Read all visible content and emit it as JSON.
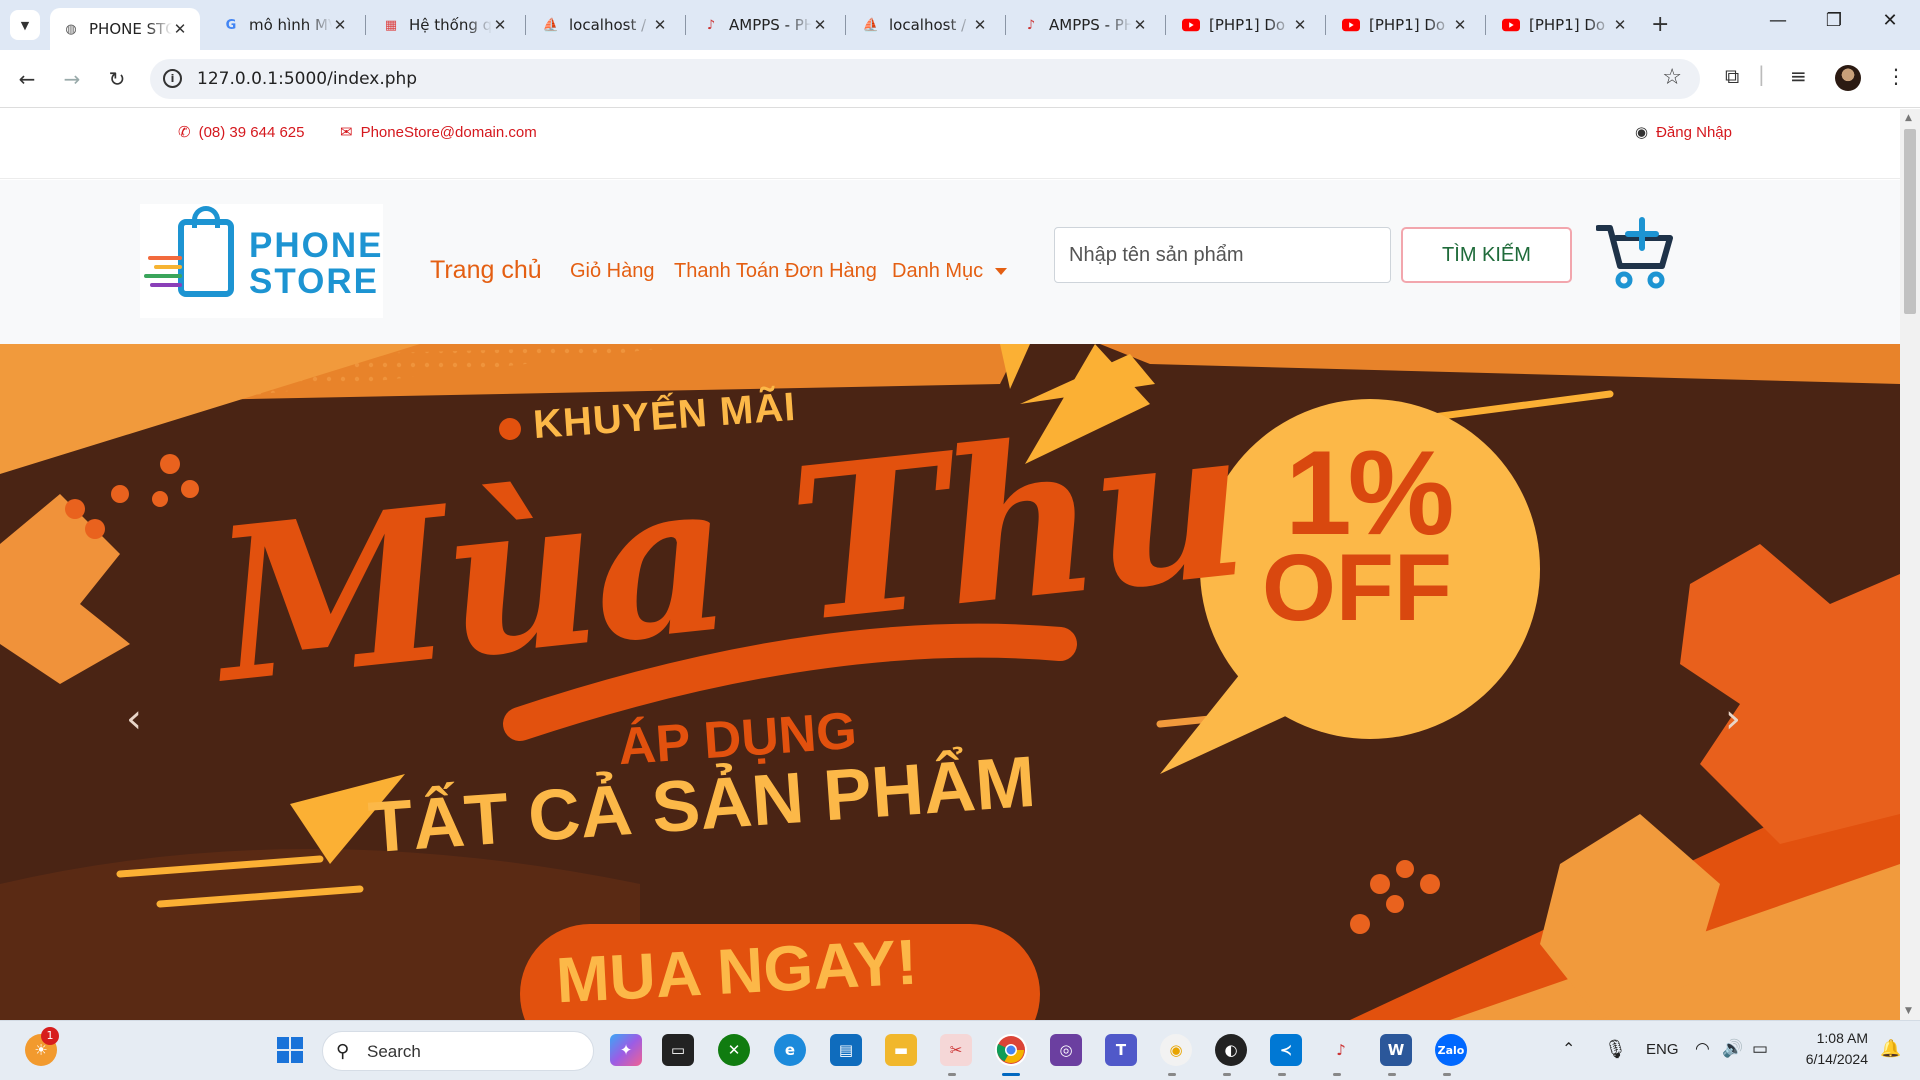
{
  "browser": {
    "tabs": [
      {
        "title": "PHONE STORE",
        "favicon": "globe-icon",
        "active": true
      },
      {
        "title": "mô hình MVC",
        "favicon": "google-icon",
        "active": false
      },
      {
        "title": "Hệ thống quản lý",
        "favicon": "site-icon",
        "active": false
      },
      {
        "title": "localhost / phpMyAdmin",
        "favicon": "phpmyadmin-icon",
        "active": false
      },
      {
        "title": "AMPPS - PHP",
        "favicon": "ampps-icon",
        "active": false
      },
      {
        "title": "localhost / phpMyAdmin",
        "favicon": "phpmyadmin-icon",
        "active": false
      },
      {
        "title": "AMPPS - PHP",
        "favicon": "ampps-icon",
        "active": false
      },
      {
        "title": "[PHP1] Do",
        "favicon": "youtube-icon",
        "active": false
      },
      {
        "title": "[PHP1] Do",
        "favicon": "youtube-icon",
        "active": false
      },
      {
        "title": "[PHP1] Do",
        "favicon": "youtube-icon",
        "active": false
      }
    ],
    "close_glyph": "✕",
    "new_tab_glyph": "+",
    "url": "127.0.0.1:5000/index.php"
  },
  "topbar": {
    "phone": "(08) 39 644 625",
    "email": "PhoneStore@domain.com",
    "login": "Đăng Nhập"
  },
  "header": {
    "logo_line1": "PHONE",
    "logo_line2": "STORE",
    "nav": {
      "home": "Trang chủ",
      "cart": "Giỏ Hàng",
      "checkout": "Thanh Toán Đơn Hàng",
      "category": "Danh Mục"
    },
    "search_placeholder": "Nhập tên sản phẩm",
    "search_button": "TÌM KIẾM"
  },
  "banner": {
    "kicker": "KHUYẾN MÃI",
    "headline": "Mùa Thu",
    "badge_percent": "1%",
    "badge_off": "OFF",
    "apply": "ÁP DỤNG",
    "all_products": "TẤT CẢ SẢN PHẨM",
    "cta": "MUA NGAY!",
    "prev": "‹",
    "next": "›"
  },
  "taskbar": {
    "search_label": "Search",
    "notification_count": "1",
    "language": "ENG",
    "time": "1:08 AM",
    "date": "6/14/2024"
  },
  "colors": {
    "accent": "#e45f12",
    "topbar_red": "#d5181e",
    "brand_blue": "#1d94d2",
    "banner_bg": "#4a2414",
    "banner_orange": "#e2510e",
    "banner_yellow": "#fbb034"
  }
}
